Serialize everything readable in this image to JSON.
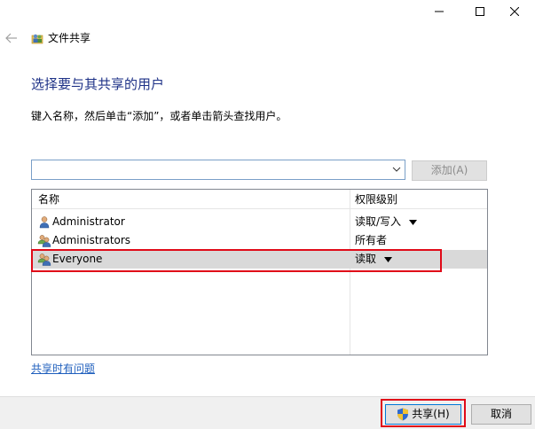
{
  "window": {
    "title": "文件共享"
  },
  "main": {
    "heading": "选择要与其共享的用户",
    "instruction": "键入名称，然后单击“添加”，或者单击箭头查找用户。",
    "name_input": {
      "value": ""
    },
    "add_button": "添加(A)",
    "table": {
      "columns": [
        "名称",
        "权限级别"
      ],
      "rows": [
        {
          "name": "Administrator",
          "permission": "读取/写入",
          "has_dropdown": true,
          "icon": "user-icon"
        },
        {
          "name": "Administrators",
          "permission": "所有者",
          "has_dropdown": false,
          "icon": "group-icon"
        },
        {
          "name": "Everyone",
          "permission": "读取",
          "has_dropdown": true,
          "icon": "group-icon",
          "selected": true
        }
      ]
    },
    "help_link": "共享时有问题"
  },
  "footer": {
    "share_button": "共享(H)",
    "cancel_button": "取消"
  },
  "colors": {
    "heading": "#1e3287",
    "link": "#1f5fbd",
    "highlight": "#e00a18",
    "selected_row": "#d9d9d9",
    "footer_bg": "#f0f0f0"
  }
}
